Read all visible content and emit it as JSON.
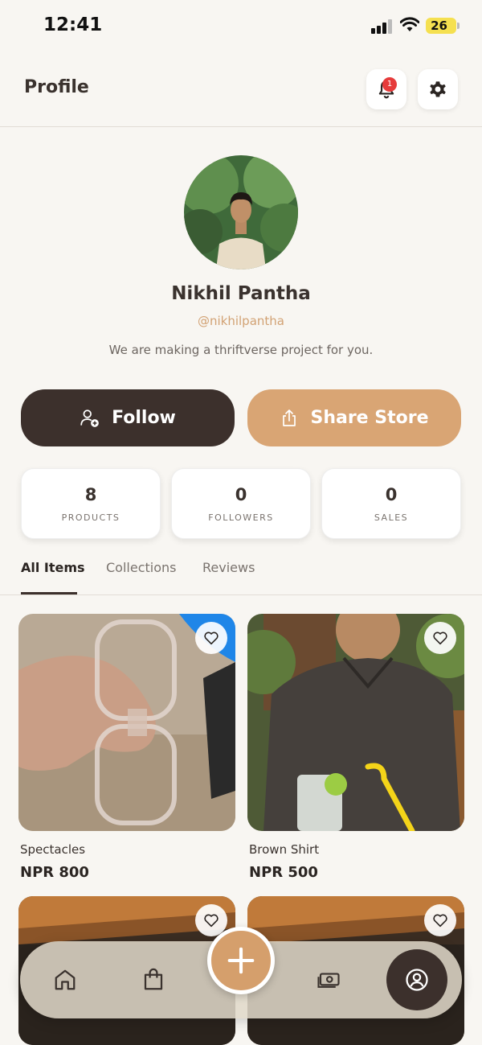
{
  "status_bar": {
    "time": "12:41",
    "battery": "26"
  },
  "header": {
    "title": "Profile",
    "notification_count": "1"
  },
  "profile": {
    "name": "Nikhil Pantha",
    "handle": "@nikhilpantha",
    "bio": "We are making a thriftverse project for you."
  },
  "actions": {
    "follow_label": "Follow",
    "share_label": "Share Store"
  },
  "stats": [
    {
      "value": "8",
      "label": "PRODUCTS"
    },
    {
      "value": "0",
      "label": "FOLLOWERS"
    },
    {
      "value": "0",
      "label": "SALES"
    }
  ],
  "tabs": [
    {
      "label": "All Items",
      "active": true
    },
    {
      "label": "Collections",
      "active": false
    },
    {
      "label": "Reviews",
      "active": false
    }
  ],
  "products": [
    {
      "name": "Spectacles",
      "price": "NPR 800"
    },
    {
      "name": "Brown Shirt",
      "price": "NPR 500"
    }
  ],
  "bottom_nav": {
    "items": [
      "home-icon",
      "bag-icon",
      "add-icon",
      "money-icon",
      "profile-icon"
    ],
    "active": "profile-icon"
  },
  "colors": {
    "accent": "#d9a574",
    "dark": "#3c302c",
    "background": "#f8f6f2",
    "badge": "#e63b3b"
  }
}
